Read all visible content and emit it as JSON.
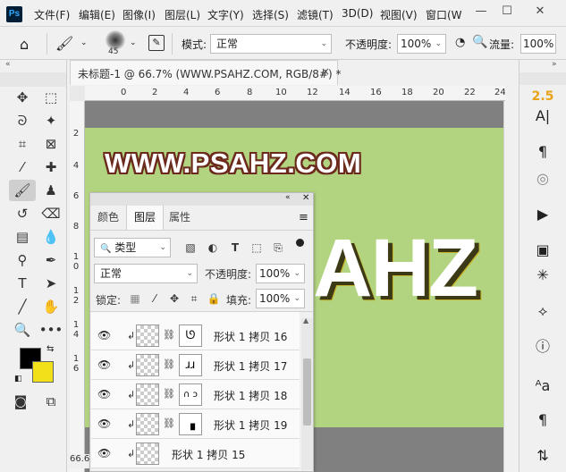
{
  "app": {
    "logo": "Ps"
  },
  "menu": [
    "文件(F)",
    "编辑(E)",
    "图像(I)",
    "图层(L)",
    "文字(Y)",
    "选择(S)",
    "滤镜(T)",
    "3D(D)",
    "视图(V)",
    "窗口(W"
  ],
  "window_controls": {
    "minimize": "—",
    "restore": "☐",
    "close": "✕"
  },
  "options": {
    "brush_size": "45",
    "mode_label": "模式:",
    "mode_value": "正常",
    "opacity_label": "不透明度:",
    "opacity_value": "100%",
    "flow_label": "流量:",
    "flow_value": "100%"
  },
  "document": {
    "tab_title": "未标题-1 @ 66.7% (WWW.PSAHZ.COM, RGB/8#) *",
    "zoom_status": "66.6"
  },
  "ruler_top": [
    "0",
    "2",
    "4",
    "6",
    "8",
    "10",
    "12",
    "14",
    "16",
    "18",
    "20",
    "22",
    "24"
  ],
  "ruler_left": [
    "2",
    "4",
    "6",
    "8",
    "1\n0",
    "1\n2",
    "1\n4",
    "1\n6"
  ],
  "canvas": {
    "watermark": "WWW.PSAHZ.COM",
    "big_text": "AHZ",
    "bg_color": "#b2d481"
  },
  "right_dock": {
    "version_badge": "2.5"
  },
  "layers_panel": {
    "tabs": [
      "颜色",
      "图层",
      "属性"
    ],
    "active_tab": "图层",
    "filter_label": "类型",
    "blend_mode": "正常",
    "opacity_label": "不透明度:",
    "opacity_value": "100%",
    "lock_label": "锁定:",
    "fill_label": "填充:",
    "fill_value": "100%",
    "layers": [
      {
        "name": "形状 1 拷贝 16",
        "mask_glyph": "ᘎ"
      },
      {
        "name": "形状 1 拷贝 17",
        "mask_glyph": "ɹɹ"
      },
      {
        "name": "形状 1 拷贝 18",
        "mask_glyph": "∩ ↄ"
      },
      {
        "name": "形状 1 拷贝 19",
        "mask_glyph": "▗"
      },
      {
        "name": "形状 1 拷贝 15",
        "mask_glyph": ""
      }
    ]
  }
}
